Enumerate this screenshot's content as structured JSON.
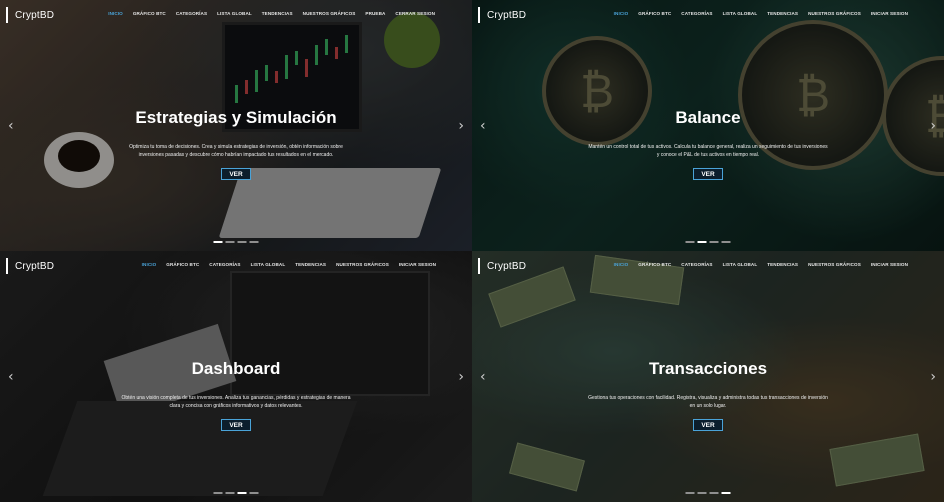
{
  "brand": "CryptBD",
  "button_label": "VER",
  "panels": [
    {
      "menu": [
        "INICIO",
        "GRÁFICO BTC",
        "CATEGORÍAS",
        "LISTA GLOBAL",
        "TENDENCIAS",
        "NUESTROS GRÁFICOS",
        "PRUEBA",
        "CERRAR SESION"
      ],
      "title": "Estrategias y Simulación",
      "description": "Optimiza tu toma de decisiones. Crea y simula estrategias de inversión, obtén información sobre inversiones pasadas y descubre cómo habrían impactado tus resultados en el mercado.",
      "active_dot": 0
    },
    {
      "menu": [
        "INICIO",
        "GRÁFICO BTC",
        "CATEGORÍAS",
        "LISTA GLOBAL",
        "TENDENCIAS",
        "NUESTROS GRÁFICOS",
        "INICIAR SESION"
      ],
      "title": "Balance",
      "description": "Mantén un control total de tus activos. Calcula tu balance general, realiza un seguimiento de tus inversiones y conoce el P&L de tus activos en tiempo real.",
      "active_dot": 1
    },
    {
      "menu": [
        "INICIO",
        "GRÁFICO BTC",
        "CATEGORÍAS",
        "LISTA GLOBAL",
        "TENDENCIAS",
        "NUESTROS GRÁFICOS",
        "INICIAR SESION"
      ],
      "title": "Dashboard",
      "description": "Obtén una visión completa de tus inversiones. Analiza tus ganancias, pérdidas y estrategias de manera clara y concisa con gráficos informativos y datos relevantes.",
      "active_dot": 2
    },
    {
      "menu": [
        "INICIO",
        "GRÁFICO BTC",
        "CATEGORÍAS",
        "LISTA GLOBAL",
        "TENDENCIAS",
        "NUESTROS GRÁFICOS",
        "INICIAR SESION"
      ],
      "title": "Transacciones",
      "description": "Gestiona tus operaciones con facilidad. Registra, visualiza y administra todas tus transacciones de inversión en un solo lugar.",
      "active_dot": 3
    }
  ],
  "arrows": {
    "prev": "‹",
    "next": "›"
  },
  "colors": {
    "accent": "#4aa3d8",
    "button_bg": "#0c1e2c"
  }
}
